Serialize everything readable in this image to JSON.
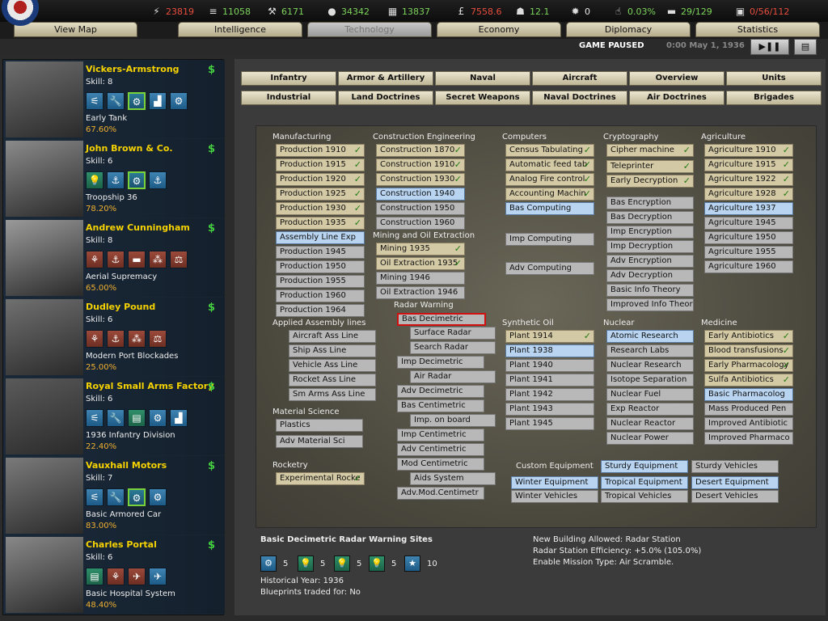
{
  "resources": [
    {
      "icon": "energy-icon",
      "glyph": "⚡",
      "value": "23819",
      "color": "red"
    },
    {
      "icon": "metal-icon",
      "glyph": "≡",
      "value": "11058",
      "color": "green"
    },
    {
      "icon": "rare-materials-icon",
      "glyph": "⚒",
      "value": "6171",
      "color": "green"
    },
    {
      "icon": "oil-icon",
      "glyph": "●",
      "value": "34342",
      "color": "green"
    },
    {
      "icon": "supplies-icon",
      "glyph": "▦",
      "value": "13837",
      "color": "green"
    },
    {
      "icon": "money-icon",
      "glyph": "£",
      "value": "7558.6",
      "color": "red"
    },
    {
      "icon": "manpower-icon",
      "glyph": "☗",
      "value": "12.1",
      "color": "green"
    },
    {
      "icon": "nuke-icon",
      "glyph": "✹",
      "value": "0",
      "color": "white"
    },
    {
      "icon": "dissent-icon",
      "glyph": "☝",
      "value": "0.03%",
      "color": "green"
    },
    {
      "icon": "transport-icon",
      "glyph": "▬",
      "value": "29/129",
      "color": "green"
    },
    {
      "icon": "escort-icon",
      "glyph": "▣",
      "value": "0/56/112",
      "color": "red"
    }
  ],
  "tabs": [
    "View Map",
    "Intelligence",
    "Technology",
    "Economy",
    "Diplomacy",
    "Statistics"
  ],
  "status": {
    "paused": "GAME PAUSED",
    "date": "0:00 May 1, 1936",
    "play": "▶❚❚",
    "menu": "▤"
  },
  "ministers": [
    {
      "name": "Vickers-Armstrong",
      "skill": "Skill: 8",
      "tech": "Early Tank",
      "pct": "67.60%",
      "icons": [
        [
          "blue",
          "wrench-icon",
          "⚟"
        ],
        [
          "blue",
          "spanner-icon",
          "🔧"
        ],
        [
          "greenb",
          "gears-icon",
          "⚙"
        ],
        [
          "blue",
          "chart-icon",
          "▟"
        ],
        [
          "blue",
          "cannon-icon",
          "⚙"
        ]
      ]
    },
    {
      "name": "John Brown & Co.",
      "skill": "Skill: 6",
      "tech": "Troopship 36",
      "pct": "78.20%",
      "icons": [
        [
          "greeni",
          "lightbulb-icon",
          "💡"
        ],
        [
          "blue",
          "anchor-icon",
          "⚓"
        ],
        [
          "greenb",
          "gears-icon",
          "⚙"
        ],
        [
          "blue",
          "ship-icon",
          "⚓"
        ]
      ]
    },
    {
      "name": "Andrew Cunningham",
      "skill": "Skill: 8",
      "tech": "Aerial Supremacy",
      "pct": "65.00%",
      "icons": [
        [
          "redi",
          "hq-icon",
          "⚘"
        ],
        [
          "redi",
          "naval-doctrine-icon",
          "⚓"
        ],
        [
          "redi",
          "carrier-icon",
          "▬"
        ],
        [
          "redi",
          "troops-icon",
          "⁂"
        ],
        [
          "redi",
          "sextant-icon",
          "⚖"
        ]
      ]
    },
    {
      "name": "Dudley Pound",
      "skill": "Skill: 6",
      "tech": "Modern Port Blockades",
      "pct": "25.00%",
      "icons": [
        [
          "redi",
          "hq-icon",
          "⚘"
        ],
        [
          "redi",
          "naval-doctrine-icon",
          "⚓"
        ],
        [
          "redi",
          "troops-icon",
          "⁂"
        ],
        [
          "redi",
          "sextant-icon",
          "⚖"
        ]
      ]
    },
    {
      "name": "Royal Small Arms Factory",
      "skill": "Skill: 6",
      "tech": "1936 Infantry Division",
      "pct": "22.40%",
      "icons": [
        [
          "blue",
          "wrench-icon",
          "⚟"
        ],
        [
          "blue",
          "spanner-icon",
          "🔧"
        ],
        [
          "greeni",
          "book-icon",
          "▤"
        ],
        [
          "blue",
          "blueprint-icon",
          "⚙"
        ],
        [
          "blue",
          "chart-icon",
          "▟"
        ]
      ]
    },
    {
      "name": "Vauxhall Motors",
      "skill": "Skill: 7",
      "tech": "Basic Armored Car",
      "pct": "83.00%",
      "icons": [
        [
          "blue",
          "wrench-icon",
          "⚟"
        ],
        [
          "blue",
          "spanner-icon",
          "🔧"
        ],
        [
          "greenb",
          "gears-icon",
          "⚙"
        ],
        [
          "blue",
          "cannon-icon",
          "⚙"
        ]
      ]
    },
    {
      "name": "Charles Portal",
      "skill": "Skill: 6",
      "tech": "Basic Hospital System",
      "pct": "48.40%",
      "icons": [
        [
          "greeni",
          "book-icon",
          "▤"
        ],
        [
          "redi",
          "hq-icon",
          "⚘"
        ],
        [
          "redi",
          "fighter-icon",
          "✈"
        ],
        [
          "blue",
          "aircraft-icon",
          "✈"
        ]
      ]
    }
  ],
  "categories_row1": [
    "Infantry",
    "Armor & Artillery",
    "Naval",
    "Aircraft",
    "Overview",
    "Units"
  ],
  "categories_row2": [
    "Industrial",
    "Land Doctrines",
    "Secret Weapons",
    "Naval Doctrines",
    "Air Doctrines",
    "Brigades"
  ],
  "tech_headers": [
    "Manufacturing",
    "Construction Engineering",
    "Computers",
    "Cryptography",
    "Agriculture",
    "Mining and Oil Extraction",
    "Radar Warning",
    "Applied Assembly lines",
    "Synthetic Oil",
    "Nuclear",
    "Medicine",
    "Material Science",
    "Rocketry",
    "Custom Equipment"
  ],
  "techs": {
    "manufacturing": [
      "Production 1910",
      "Production 1915",
      "Production 1920",
      "Production 1925",
      "Production 1930",
      "Production 1935",
      "Assembly Line Exp",
      "Production 1945",
      "Production 1950",
      "Production 1955",
      "Production 1960",
      "Production 1964"
    ],
    "construction": [
      "Construction 1870",
      "Construction 1910",
      "Construction 1930",
      "Construction 1940",
      "Construction 1950",
      "Construction 1960"
    ],
    "mining": [
      "Mining 1935",
      "Oil Extraction 1935",
      "Mining 1946",
      "Oil Extraction 1946"
    ],
    "radar": [
      "Bas Decimetric",
      "Surface Radar",
      "Search Radar",
      "Imp Decimetric",
      "Air Radar",
      "Adv Decimetric",
      "Bas Centimetric",
      "Imp. on board",
      "Imp Centimetric",
      "Adv Centimetric",
      "Mod Centimetric",
      "Aids System",
      "Adv.Mod.Centimetr"
    ],
    "computers": [
      "Census Tabulating",
      "Automatic feed tab",
      "Analog Fire control",
      "Accounting Machin",
      "Bas Computing",
      "Imp Computing",
      "Adv Computing"
    ],
    "crypto": [
      "Cipher machine",
      "Teleprinter",
      "Early Decryption",
      "Bas Encryption",
      "Bas Decryption",
      "Imp Encryption",
      "Imp Decryption",
      "Adv Encryption",
      "Adv Decryption",
      "Basic Info Theory",
      "Improved Info Theor"
    ],
    "agriculture": [
      "Agriculture 1910",
      "Agriculture 1915",
      "Agriculture 1922",
      "Agriculture 1928",
      "Agriculture 1937",
      "Agriculture 1945",
      "Agriculture 1950",
      "Agriculture 1955",
      "Agriculture 1960"
    ],
    "assembly": [
      "Aircraft Ass Line",
      "Ship Ass Line",
      "Vehicle Ass Line",
      "Rocket Ass Line",
      "Sm Arms Ass Line"
    ],
    "synthetic": [
      "Plant 1914",
      "Plant 1938",
      "Plant 1940",
      "Plant 1941",
      "Plant 1942",
      "Plant 1943",
      "Plant 1945"
    ],
    "nuclear": [
      "Atomic Research",
      "Research Labs",
      "Nuclear Research",
      "Isotope Separation",
      "Nuclear Fuel",
      "Exp Reactor",
      "Nuclear Reactor",
      "Nuclear Power"
    ],
    "medicine": [
      "Early Antibiotics",
      "Blood transfusions",
      "Early Pharmacology",
      "Sulfa Antibiotics",
      "Basic Pharmacolog",
      "Mass Produced Pen",
      "Improved Antibiotic",
      "Improved Pharmaco"
    ],
    "material": [
      "Plastics",
      "Adv Material Sci"
    ],
    "rocketry": [
      "Experimental Rocke"
    ],
    "custom": [
      "Sturdy Equipment",
      "Sturdy Vehicles",
      "Winter Equipment",
      "Tropical Equipment",
      "Desert Equipment",
      "Winter Vehicles",
      "Tropical Vehicles",
      "Desert Vehicles"
    ]
  },
  "description": {
    "title": "Basic Decimetric Radar Warning Sites",
    "blueprints": [
      {
        "icon": "gears-icon",
        "glyph": "⚙",
        "value": "5"
      },
      {
        "icon": "lightbulb-icon",
        "glyph": "💡",
        "value": "5"
      },
      {
        "icon": "lightbulb-icon",
        "glyph": "💡",
        "value": "5"
      },
      {
        "icon": "lightbulb-icon",
        "glyph": "💡",
        "value": "5"
      },
      {
        "icon": "star-icon",
        "glyph": "★",
        "value": "10"
      }
    ],
    "historical_year": "Historical Year: 1936",
    "traded": "Blueprints traded for: No",
    "effects": [
      "New Building Allowed: Radar Station",
      "Radar Station Efficiency: +5.0% (105.0%)",
      "Enable Mission Type: Air Scramble."
    ]
  }
}
